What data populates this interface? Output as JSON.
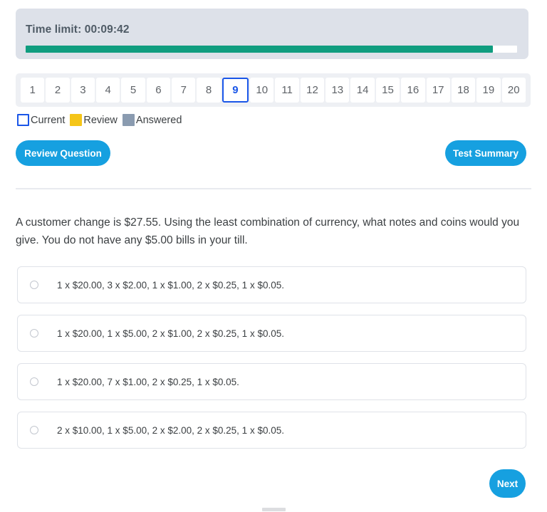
{
  "timer": {
    "label": "Time limit: 00:09:42",
    "progress_percent": 95,
    "fill_color": "#0f9d7f",
    "panel_color": "#dde1e9"
  },
  "question_nav": {
    "numbers": [
      "1",
      "2",
      "3",
      "4",
      "5",
      "6",
      "7",
      "8",
      "9",
      "10",
      "11",
      "12",
      "13",
      "14",
      "15",
      "16",
      "17",
      "18",
      "19",
      "20"
    ],
    "current_index": 8,
    "current_number": "9",
    "accent_color": "#1a56e8"
  },
  "legend": {
    "items": [
      {
        "label": "Current",
        "swatch": "current",
        "color": "#1a56e8"
      },
      {
        "label": "Review",
        "swatch": "review",
        "color": "#f5c518"
      },
      {
        "label": "Answered",
        "swatch": "answered",
        "color": "#8a9bb0"
      }
    ]
  },
  "toolbar": {
    "review_question_label": "Review Question",
    "test_summary_label": "Test Summary",
    "button_color": "#16a0e0"
  },
  "question": {
    "text": "A customer change is $27.55. Using the least combination of currency, what notes and coins would you give. You do not have any $5.00 bills in your till.",
    "options": [
      {
        "id": "option-a",
        "text": "1 x $20.00, 3 x $2.00, 1 x $1.00, 2 x $0.25, 1 x $0.05.",
        "selected": false
      },
      {
        "id": "option-b",
        "text": "1 x $20.00, 1 x $5.00, 2 x $1.00, 2 x $0.25, 1 x $0.05.",
        "selected": false
      },
      {
        "id": "option-c",
        "text": "1 x $20.00, 7 x $1.00, 2 x $0.25, 1 x $0.05.",
        "selected": false
      },
      {
        "id": "option-d",
        "text": "2 x $10.00, 1 x $5.00, 2 x $2.00, 2 x $0.25, 1 x $0.05.",
        "selected": false
      }
    ]
  },
  "footer": {
    "next_label": "Next"
  }
}
